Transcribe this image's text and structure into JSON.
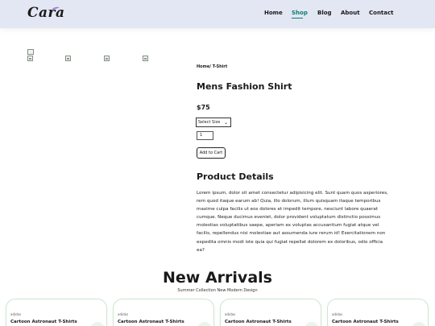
{
  "brand": {
    "logo": "Cara"
  },
  "nav": [
    {
      "label": "Home"
    },
    {
      "label": "Shop"
    },
    {
      "label": "Blog"
    },
    {
      "label": "About"
    },
    {
      "label": "Contact"
    }
  ],
  "breadcrumb": "Home/ T-Shirt",
  "product": {
    "title": "Mens Fashion Shirt",
    "price": "$75",
    "size_select": "Select Size",
    "quantity": "1",
    "add_to_cart": "Add to Cart"
  },
  "details": {
    "title": "Product Details",
    "text": "Lorem ipsum, dolor sit amet consectetur adipisicing elit. Sunt quam quos asperiores, rem quod itaque earum ab! Quia, illo dolorum, illum quisquam itaque temporibus maxime culpa facilis ut eos dolores et impedit tempore, nesciunt labore quaerat cumque. Neque ducimus eveniet, dolor provident voluptatum distinctio possimus molestias voluptatibus saepe, aperiam ex voluptas accusantium fugiat atque vel facilis, repellendus nisi molestiae aut assumenda iure rerum id! Exercitationem non expedita omnis modi iste quia qui fugiat repellat dolorem ex doloribus, odio officia ea?"
  },
  "arrivals": {
    "title": "New Arrivals",
    "subtitle": "Summer Collection New Modern Design",
    "cards": [
      {
        "brand": "adidas",
        "name": "Cartoon Astronaut T-Shirts"
      },
      {
        "brand": "adidas",
        "name": "Cartoon Astronaut T-Shirts"
      },
      {
        "brand": "adidas",
        "name": "Cartoon Astronaut T-Shirts"
      },
      {
        "brand": "adidas",
        "name": "Cartoon Astronaut T-Shirts"
      }
    ]
  },
  "colors": {
    "header_bg": "#e3e6f3",
    "accent": "#088178",
    "card_border": "#cce7d0"
  },
  "icons": {
    "cart": "cart-icon"
  }
}
